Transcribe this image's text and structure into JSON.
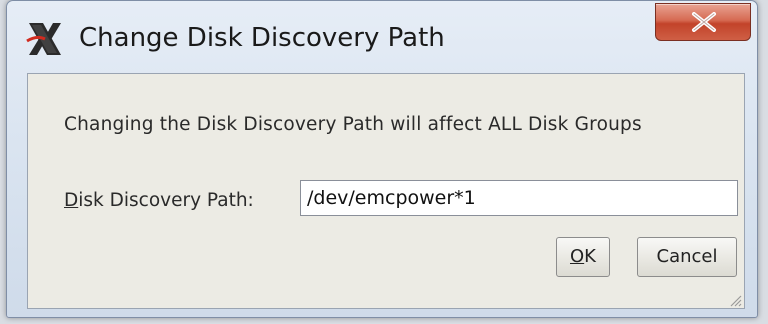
{
  "dialog": {
    "title": "Change Disk Discovery Path",
    "message": "Changing the Disk Discovery Path will affect ALL Disk Groups",
    "path_label_mnemonic": "D",
    "path_label_rest": "isk Discovery Path:",
    "path_value": "/dev/emcpower*1",
    "ok_mnemonic": "O",
    "ok_rest": "K",
    "cancel_label": "Cancel"
  },
  "icons": {
    "app": "oracle-x-icon",
    "close": "close-icon",
    "resize": "resize-grip-icon"
  },
  "colors": {
    "close_button": "#c2432a",
    "panel_background": "#ecebe4",
    "window_frame": "#dbe5f1"
  }
}
